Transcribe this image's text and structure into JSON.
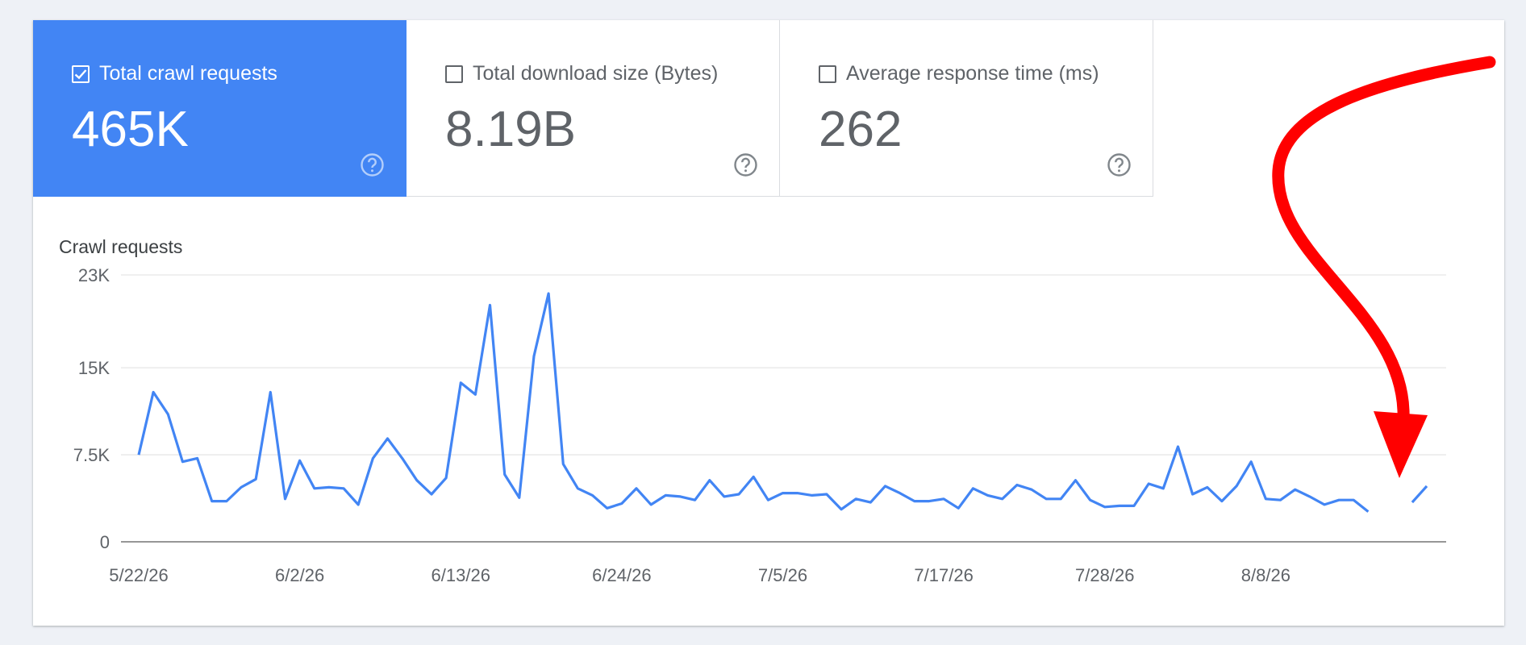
{
  "metrics": [
    {
      "label": "Total crawl requests",
      "value": "465K",
      "checked": true
    },
    {
      "label": "Total download size (Bytes)",
      "value": "8.19B",
      "checked": false
    },
    {
      "label": "Average response time (ms)",
      "value": "262",
      "checked": false
    }
  ],
  "help_icon": "help-circle-icon",
  "colors": {
    "accent": "#4285f4",
    "line": "#4285f4",
    "annotation_arrow": "#ff0000"
  },
  "chart_data": {
    "type": "line",
    "title": "Crawl requests",
    "ylim": [
      0,
      23000
    ],
    "y_ticks": [
      {
        "value": 0,
        "label": "0"
      },
      {
        "value": 7500,
        "label": "7.5K"
      },
      {
        "value": 15000,
        "label": "15K"
      },
      {
        "value": 23000,
        "label": "23K"
      }
    ],
    "x_ticks": [
      "5/22/26",
      "6/2/26",
      "6/13/26",
      "6/24/26",
      "7/5/26",
      "7/17/26",
      "7/28/26",
      "8/8/26"
    ],
    "grid": true,
    "series": [
      {
        "values": [
          7500,
          12900,
          11000,
          6900,
          7200,
          3500,
          3500,
          4700,
          5400,
          12900,
          3700,
          7000,
          4600,
          4700,
          4600,
          3200,
          7200,
          8900,
          7200,
          5300,
          4100,
          5500,
          13700,
          12700,
          20400,
          5800,
          3800,
          16000,
          21400,
          6700,
          4600,
          4000,
          2900,
          3300,
          4600,
          3200,
          4000,
          3900,
          3600,
          5300,
          3900,
          4100,
          5600,
          3600,
          4200,
          4200,
          4000,
          4100,
          2800,
          3700,
          3400,
          4800,
          4200,
          3500,
          3500,
          3700,
          2900,
          4600,
          4000,
          3700,
          4900,
          4500,
          3700,
          3700,
          5300,
          3600,
          3000,
          3100,
          3100,
          5000,
          4600,
          8200,
          4100,
          4700,
          3500,
          4800,
          6900,
          3700,
          3600,
          4500,
          3900,
          3200,
          3600,
          3600,
          2600,
          null,
          null,
          3400,
          4800
        ]
      }
    ]
  },
  "annotation": {
    "type": "arrow",
    "color": "#ff0000"
  }
}
